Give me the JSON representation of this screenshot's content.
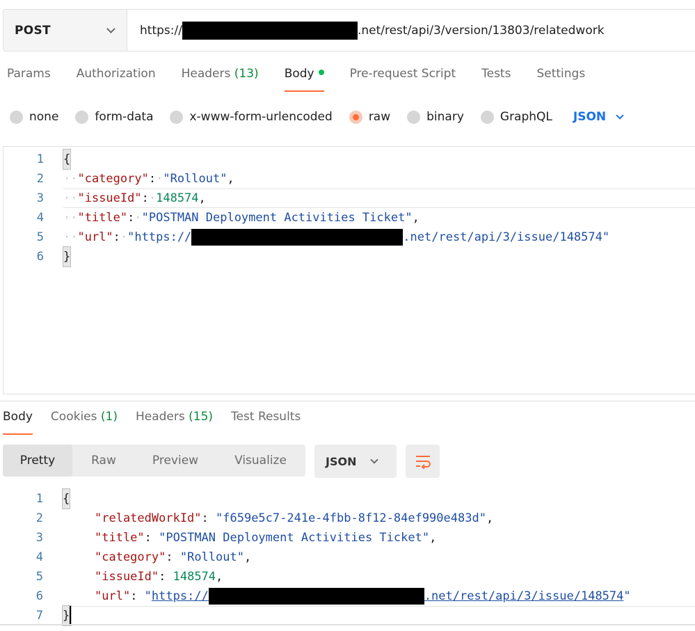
{
  "request": {
    "method": "POST",
    "url_prefix": "https://",
    "url_suffix": ".net/rest/api/3/version/13803/relatedwork"
  },
  "request_tabs": [
    {
      "label": "Params"
    },
    {
      "label": "Authorization"
    },
    {
      "label": "Headers",
      "count": "(13)"
    },
    {
      "label": "Body"
    },
    {
      "label": "Pre-request Script"
    },
    {
      "label": "Tests"
    },
    {
      "label": "Settings"
    }
  ],
  "body_types": {
    "none": "none",
    "form_data": "form-data",
    "urlencoded": "x-www-form-urlencoded",
    "raw": "raw",
    "binary": "binary",
    "graphql": "GraphQL",
    "language": "JSON"
  },
  "request_body": {
    "line_numbers": [
      "1",
      "2",
      "3",
      "4",
      "5",
      "6"
    ],
    "open_brace": "{",
    "close_brace": "}",
    "category_key": "\"category\"",
    "category_value": "\"Rollout\"",
    "issueId_key": "\"issueId\"",
    "issueId_value": "148574",
    "title_key": "\"title\"",
    "title_value": "\"POSTMAN Deployment Activities Ticket\"",
    "url_key": "\"url\"",
    "url_value_prefix": "\"https://",
    "url_value_suffix": ".net/rest/api/3/issue/148574\""
  },
  "response_tabs": [
    {
      "label": "Body"
    },
    {
      "label": "Cookies",
      "count": "(1)"
    },
    {
      "label": "Headers",
      "count": "(15)"
    },
    {
      "label": "Test Results"
    }
  ],
  "response_view": {
    "modes": [
      "Pretty",
      "Raw",
      "Preview",
      "Visualize"
    ],
    "format": "JSON"
  },
  "response_body": {
    "line_numbers": [
      "1",
      "2",
      "3",
      "4",
      "5",
      "6",
      "7"
    ],
    "open_brace": "{",
    "close_brace": "}",
    "relatedWorkId_key": "\"relatedWorkId\"",
    "relatedWorkId_value": "\"f659e5c7-241e-4fbb-8f12-84ef990e483d\"",
    "title_key": "\"title\"",
    "title_value": "\"POSTMAN Deployment Activities Ticket\"",
    "category_key": "\"category\"",
    "category_value": "\"Rollout\"",
    "issueId_key": "\"issueId\"",
    "issueId_value": "148574",
    "url_key": "\"url\"",
    "url_quote": "\"",
    "url_link_prefix": "https://",
    "url_link_suffix": ".net/rest/api/3/issue/148574"
  },
  "colors": {
    "accent": "#ff6c37",
    "count_green": "#0a8a3a",
    "json_key": "#a31515",
    "json_string": "#1f4ea3",
    "json_number": "#098658",
    "language_blue": "#1a73e8"
  }
}
